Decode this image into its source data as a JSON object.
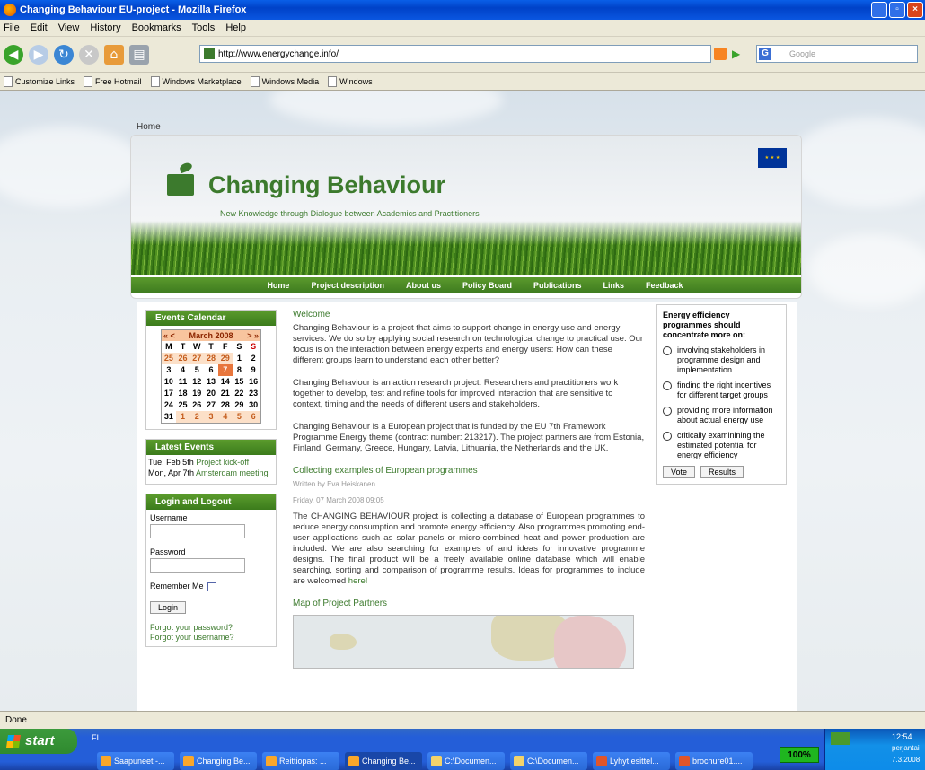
{
  "window": {
    "title": "Changing Behaviour EU-project - Mozilla Firefox"
  },
  "menu": [
    "File",
    "Edit",
    "View",
    "History",
    "Bookmarks",
    "Tools",
    "Help"
  ],
  "address": {
    "url": "http://www.energychange.info/",
    "search_placeholder": "Google"
  },
  "bookmarks": [
    "Customize Links",
    "Free Hotmail",
    "Windows Marketplace",
    "Windows Media",
    "Windows"
  ],
  "page": {
    "breadcrumb": "Home",
    "brand": "Changing Behaviour",
    "tagline": "New Knowledge through Dialogue between Academics and Practitioners",
    "nav": [
      "Home",
      "Project description",
      "About us",
      "Policy Board",
      "Publications",
      "Links",
      "Feedback"
    ]
  },
  "calendar": {
    "title": "Events Calendar",
    "prev": "« <",
    "month": "March 2008",
    "next": "> »",
    "daynames": [
      "M",
      "T",
      "W",
      "T",
      "F",
      "S",
      "S"
    ],
    "days": [
      "25",
      "26",
      "27",
      "28",
      "29",
      "1",
      "2",
      "3",
      "4",
      "5",
      "6",
      "7",
      "8",
      "9",
      "10",
      "11",
      "12",
      "13",
      "14",
      "15",
      "16",
      "17",
      "18",
      "19",
      "20",
      "21",
      "22",
      "23",
      "24",
      "25",
      "26",
      "27",
      "28",
      "29",
      "30",
      "31",
      "1",
      "2",
      "3",
      "4",
      "5",
      "6"
    ]
  },
  "latest_events": {
    "title": "Latest Events",
    "items": [
      {
        "date": "Tue, Feb 5th",
        "link": "Project kick-off"
      },
      {
        "date": "Mon, Apr 7th",
        "link": "Amsterdam meeting"
      }
    ]
  },
  "login": {
    "title": "Login and Logout",
    "username_label": "Username",
    "password_label": "Password",
    "remember_label": "Remember Me",
    "button": "Login",
    "forgot_password": "Forgot your password?",
    "forgot_username": "Forgot your username?"
  },
  "article": {
    "welcome_title": "Welcome",
    "p1": "Changing Behaviour is a project that aims to support change in energy use and energy services. We do so by applying social research on technological change to practical use. Our focus is on the interaction between energy experts and energy users: How can these different groups learn to understand each other better?",
    "p2": "Changing Behaviour is an action research project. Researchers and practitioners work together to develop, test and refine tools for improved interaction that are sensitive to context, timing and the needs of different users and stakeholders.",
    "p3": "Changing Behaviour is a European project that is funded by the EU 7th Framework Programme Energy theme (contract number: 213217). The project partners are from Estonia, Finland, Germany, Greece, Hungary, Latvia, Lithuania, the Netherlands and the UK.",
    "second_title": "Collecting examples of European programmes",
    "author": "Written by Eva Heiskanen",
    "date": "Friday, 07 March 2008 09:05",
    "p4": "The CHANGING BEHAVIOUR project is collecting a database of European programmes to reduce energy consumption and promote energy efficiency. Also programmes promoting end-user applications such as solar panels or micro-combined heat and power production are included. We are also searching for examples of and ideas for innovative programme designs. The final product will be a freely available online database which will enable searching, sorting and comparison of programme results. Ideas for programmes to include are welcomed",
    "here": "here!",
    "map_title": "Map of Project Partners"
  },
  "poll": {
    "question": "Energy efficiency programmes should concentrate more on:",
    "options": [
      "involving stakeholders in programme design and implementation",
      "finding the right incentives for different target groups",
      "providing more information about actual energy use",
      "critically examinining the estimated potential for energy efficiency"
    ],
    "vote": "Vote",
    "results": "Results"
  },
  "status": {
    "text": "Done"
  },
  "taskbar": {
    "start": "start",
    "quicklaunch": "FI",
    "tasks": [
      "Saapuneet -...",
      "Changing Be...",
      "Reittiopas: ...",
      "Changing Be...",
      "C:\\Documen...",
      "C:\\Documen...",
      "Lyhyt esittel...",
      "brochure01...."
    ],
    "zoom": "100%",
    "time": "12:54",
    "day": "perjantai",
    "date": "7.3.2008"
  }
}
